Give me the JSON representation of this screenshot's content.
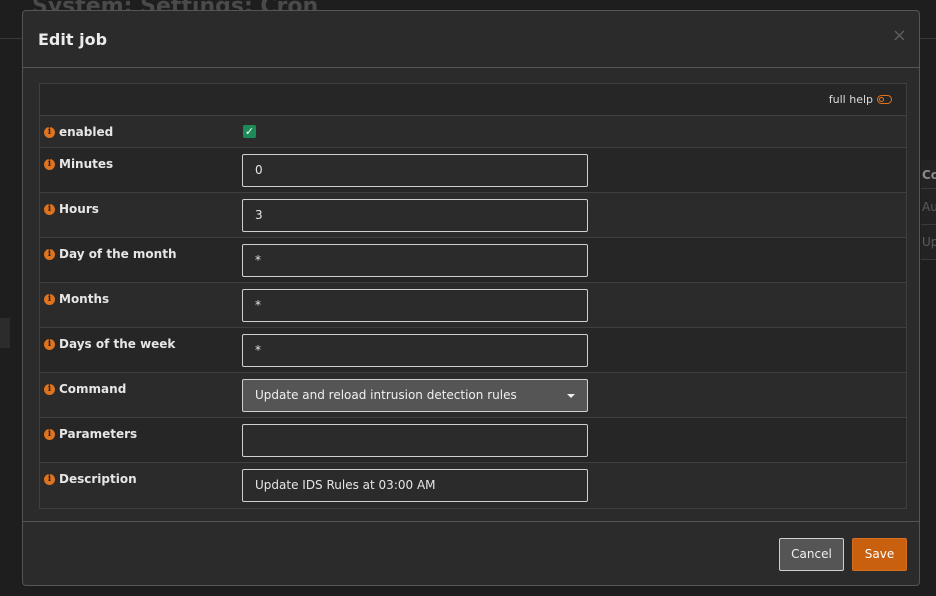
{
  "background": {
    "page_title": "System: Settings: Cron",
    "table_cells": [
      "Co",
      "Au",
      "Up"
    ]
  },
  "modal": {
    "title": "Edit job",
    "close_glyph": "×",
    "full_help_label": "full help",
    "info_glyph": "i",
    "fields": {
      "enabled": {
        "label": "enabled",
        "checked": true,
        "check_glyph": "✓"
      },
      "minutes": {
        "label": "Minutes",
        "value": "0"
      },
      "hours": {
        "label": "Hours",
        "value": "3"
      },
      "day_of_month": {
        "label": "Day of the month",
        "value": "*"
      },
      "months": {
        "label": "Months",
        "value": "*"
      },
      "days_of_week": {
        "label": "Days of the week",
        "value": "*"
      },
      "command": {
        "label": "Command",
        "value": "Update and reload intrusion detection rules"
      },
      "parameters": {
        "label": "Parameters",
        "value": ""
      },
      "description": {
        "label": "Description",
        "value": "Update IDS Rules at 03:00 AM"
      }
    },
    "buttons": {
      "cancel": "Cancel",
      "save": "Save"
    }
  },
  "colors": {
    "accent": "#e0731d",
    "save_button": "#c8600f",
    "checkbox": "#1e8a5a"
  }
}
